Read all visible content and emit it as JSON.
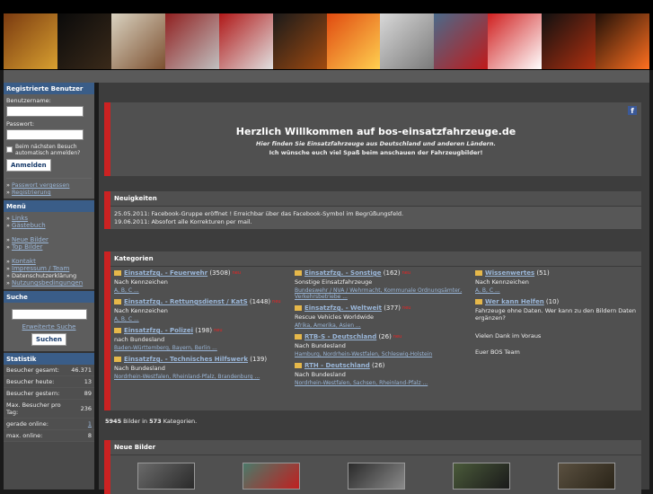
{
  "sidebar": {
    "registered_header": "Registrierte Benutzer",
    "username_label": "Benutzername:",
    "password_label": "Passwort:",
    "remember_label": "Beim nächsten Besuch automatisch anmelden?",
    "login_button": "Anmelden",
    "forgot_password": "Passwort vergessen",
    "register": "Registrierung",
    "menu_header": "Menü",
    "menu_items": [
      "Links",
      "Gästebuch"
    ],
    "menu_items2": [
      "Neue Bilder",
      "Top Bilder"
    ],
    "menu_items3": [
      "Kontakt",
      "Impressum / Team"
    ],
    "privacy_text": "Datenschutzerklärung",
    "terms_link": "Nutzungsbedingungen",
    "search_header": "Suche",
    "extended_search": "Erweiterte Suche",
    "search_button": "Suchen",
    "stats_header": "Statistik",
    "stats": [
      {
        "label": "Besucher gesamt:",
        "value": "46.371"
      },
      {
        "label": "Besucher heute:",
        "value": "13"
      },
      {
        "label": "Besucher gestern:",
        "value": "89"
      },
      {
        "label": "Max. Besucher pro Tag:",
        "value": "236"
      },
      {
        "label": "gerade online:",
        "value": "1"
      },
      {
        "label": "max. online:",
        "value": "8"
      }
    ]
  },
  "welcome": {
    "title": "Herzlich Willkommen auf bos-einsatzfahrzeuge.de",
    "subtitle": "Hier finden Sie Einsatzfahrzeuge aus Deutschland und anderen Ländern.",
    "subtitle2": "Ich wünsche euch viel Spaß beim anschauen der Fahrzeugbilder!",
    "fb_icon": "f"
  },
  "news": {
    "header": "Neuigkeiten",
    "items": [
      "25.05.2011: Facebook-Gruppe eröffnet ! Erreichbar über das Facebook-Symbol im Begrüßungsfeld.",
      "19.06.2011: Absofort alle Korrekturen per mail."
    ]
  },
  "categories": {
    "header": "Kategorien",
    "col1": [
      {
        "name": "Einsatzfzg. - Feuerwehr",
        "count": "(3508)",
        "neu": "neu",
        "desc": "Nach Kennzeichen",
        "subs": "A, B, C ..."
      },
      {
        "name": "Einsatzfzg. - Rettungsdienst / KatS",
        "count": "(1448)",
        "neu": "neu",
        "desc": "Nach Kennzeichen",
        "subs": "A, B, C ..."
      },
      {
        "name": "Einsatzfzg. - Polizei",
        "count": "(198)",
        "neu": "neu",
        "desc": "nach Bundesland",
        "subs": "Baden-Württemberg, Bayern, Berlin ..."
      },
      {
        "name": "Einsatzfzg. - Technisches Hilfswerk",
        "count": "(139)",
        "neu": "",
        "desc": "Nach Bundesland",
        "subs": "Nordrhein-Westfalen, Rheinland-Pfalz, Brandenburg ..."
      }
    ],
    "col2": [
      {
        "name": "Einsatzfzg. - Sonstige",
        "count": "(162)",
        "neu": "neu",
        "desc": "Sonstige Einsatzfahrzeuge",
        "subs": "Bundeswehr / NVA / Wehrmacht, Kommunale Ordnungsämter, Verkehrsbetriebe ..."
      },
      {
        "name": "Einsatzfzg. - Weltweit",
        "count": "(377)",
        "neu": "neu",
        "desc": "Rescue Vehicles Worldwide",
        "subs": "Afrika, Amerika, Asien ..."
      },
      {
        "name": "RTB-S - Deutschland",
        "count": "(26)",
        "neu": "neu",
        "desc": "Nach Bundesland",
        "subs": "Hamburg, Nordrhein-Westfalen, Schleswig-Holstein"
      },
      {
        "name": "RTH - Deutschland",
        "count": "(26)",
        "neu": "",
        "desc": "Nach Bundesland",
        "subs": "Nordrhein-Westfalen, Sachsen, Rheinland-Pfalz ..."
      }
    ],
    "col3": [
      {
        "name": "Wissenwertes",
        "count": "(51)",
        "neu": "",
        "desc": "Nach Kennzeichen",
        "subs": "A, B, C ..."
      },
      {
        "name": "Wer kann Helfen",
        "count": "(10)",
        "neu": "",
        "desc": "Fahrzeuge ohne Daten. Wer kann zu den Bildern Daten ergänzen?",
        "subs": ""
      }
    ],
    "thanks": "Vielen Dank im Voraus",
    "team": "Euer BOS Team"
  },
  "summary": {
    "pics": "5945",
    "text1": " Bilder in ",
    "cats": "573",
    "text2": " Kategorien."
  },
  "newpics": {
    "header": "Neue Bilder"
  }
}
